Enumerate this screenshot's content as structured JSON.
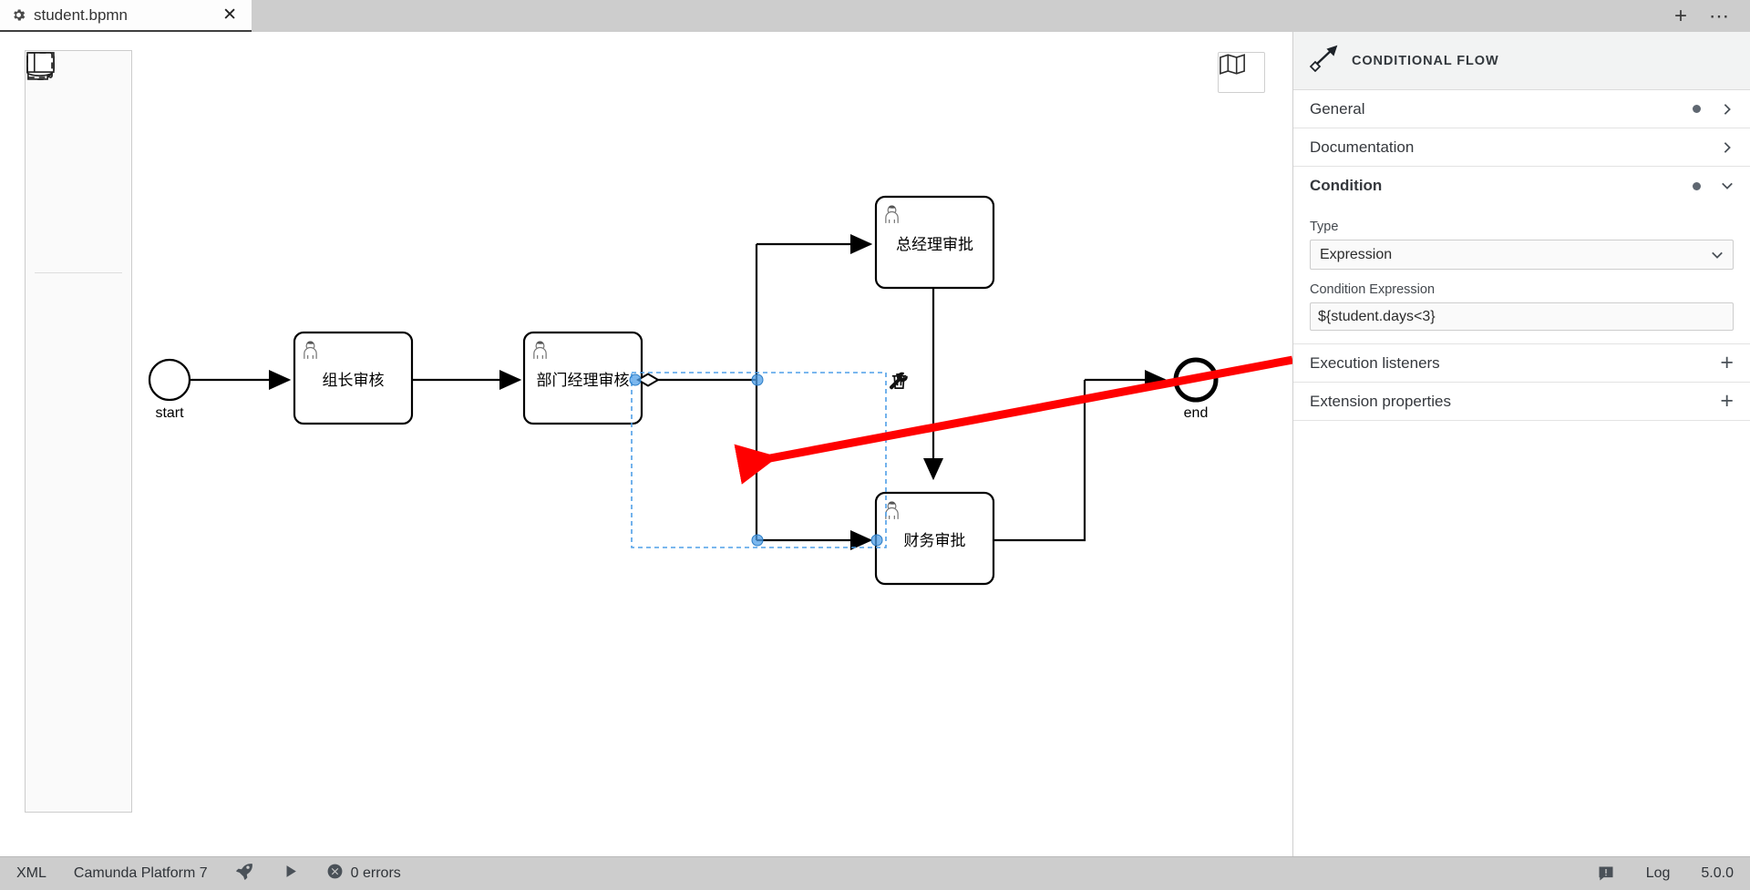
{
  "window": {
    "tab": {
      "title": "student.bpmn",
      "gear_icon": "gear-icon",
      "close_icon": "close-icon"
    },
    "new_tab_label": "+",
    "more_label": "⋯"
  },
  "palette": {
    "tools": [
      {
        "name": "hand-tool",
        "title": "Activate hand tool"
      },
      {
        "name": "lasso-tool",
        "title": "Activate lasso tool"
      },
      {
        "name": "space-tool",
        "title": "Activate create/remove space tool"
      },
      {
        "name": "global-connect-tool",
        "title": "Activate global connect tool"
      }
    ],
    "elements": [
      {
        "name": "create-start-event",
        "title": "Create StartEvent"
      },
      {
        "name": "create-intermediate-event",
        "title": "Create Intermediate/Boundary Event"
      },
      {
        "name": "create-end-event",
        "title": "Create EndEvent"
      },
      {
        "name": "create-gateway",
        "title": "Create Gateway"
      },
      {
        "name": "create-task",
        "title": "Create Task"
      },
      {
        "name": "create-subprocess",
        "title": "Create expanded SubProcess"
      },
      {
        "name": "create-data-object",
        "title": "Create DataObjectReference"
      },
      {
        "name": "create-data-store",
        "title": "Create DataStoreReference"
      },
      {
        "name": "create-participant",
        "title": "Create Pool/Participant"
      },
      {
        "name": "create-group",
        "title": "Create Group"
      }
    ]
  },
  "minimap": {
    "name": "toggle-minimap",
    "title": "Toggle minimap"
  },
  "diagram": {
    "start_event_label": "start",
    "end_event_label": "end",
    "tasks": [
      {
        "id": "task-group-leader",
        "label": "组长审核"
      },
      {
        "id": "task-dept-manager",
        "label": "部门经理审核"
      },
      {
        "id": "task-general-manager",
        "label": "总经理审批"
      },
      {
        "id": "task-finance",
        "label": "财务审批"
      }
    ],
    "context_pad": [
      {
        "name": "wrench-icon",
        "title": "Change element"
      },
      {
        "name": "trash-icon",
        "title": "Remove"
      }
    ],
    "annotation_arrow_color": "#ff0000",
    "selection_color": "#4f9fe8"
  },
  "properties": {
    "header_title": "Conditional flow",
    "header_icon": "conditional-flow-icon",
    "sections": [
      {
        "id": "general",
        "label": "General",
        "has_dot": true,
        "expanded": false,
        "chevron": "chevron-right-icon"
      },
      {
        "id": "documentation",
        "label": "Documentation",
        "has_dot": false,
        "expanded": false,
        "chevron": "chevron-right-icon"
      },
      {
        "id": "condition",
        "label": "Condition",
        "has_dot": true,
        "expanded": true,
        "chevron": "chevron-down-icon"
      }
    ],
    "condition": {
      "type_label": "Type",
      "type_value": "Expression",
      "expression_label": "Condition Expression",
      "expression_value": "${student.days<3}"
    },
    "list_sections": [
      {
        "id": "execution-listeners",
        "label": "Execution listeners",
        "add_label": "+"
      },
      {
        "id": "extension-properties",
        "label": "Extension properties",
        "add_label": "+"
      }
    ]
  },
  "status_bar": {
    "xml_label": "XML",
    "engine_label": "Camunda Platform 7",
    "deploy_icon": "rocket-icon",
    "run_icon": "play-icon",
    "error_icon": "error-icon",
    "errors_label": "0 errors",
    "notify_icon": "notification-icon",
    "log_label": "Log",
    "version_label": "5.0.0"
  }
}
